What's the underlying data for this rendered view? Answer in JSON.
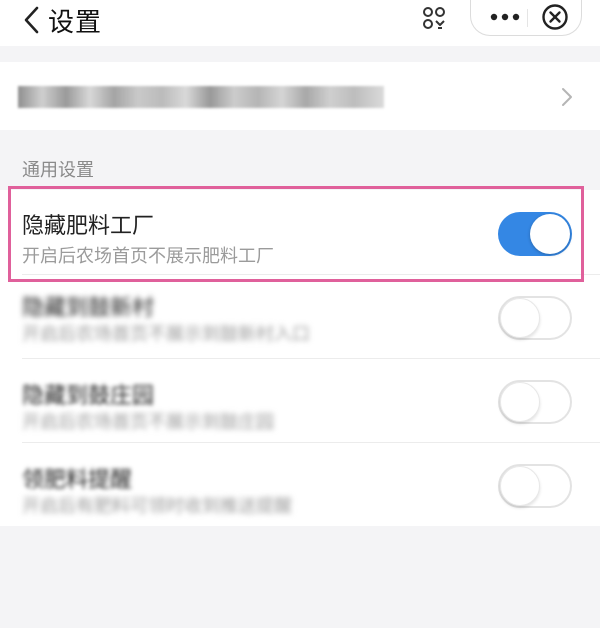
{
  "header": {
    "back_icon": "chevron-left-icon",
    "title": "设置",
    "scan_icon": "scan-icon",
    "more_icon": "more-dots-icon",
    "close_icon": "close-circle-icon"
  },
  "account_row": {
    "value": "",
    "chevron_icon": "chevron-right-icon"
  },
  "section": {
    "title": "通用设置"
  },
  "settings": [
    {
      "label": "隐藏肥料工厂",
      "description": "开启后农场首页不展示肥料工厂",
      "enabled": true
    },
    {
      "label": "隐藏到鼓新村",
      "description": "开启后农场首页不展示到鼓新村入口",
      "enabled": false
    },
    {
      "label": "隐藏到鼓庄园",
      "description": "开启后农场首页不展示到鼓庄园",
      "enabled": false
    },
    {
      "label": "领肥料提醒",
      "description": "开启后有肥料可领时收到推送提醒",
      "enabled": false
    }
  ],
  "colors": {
    "toggle_on": "#3487e4",
    "highlight_border": "#e0609b"
  }
}
